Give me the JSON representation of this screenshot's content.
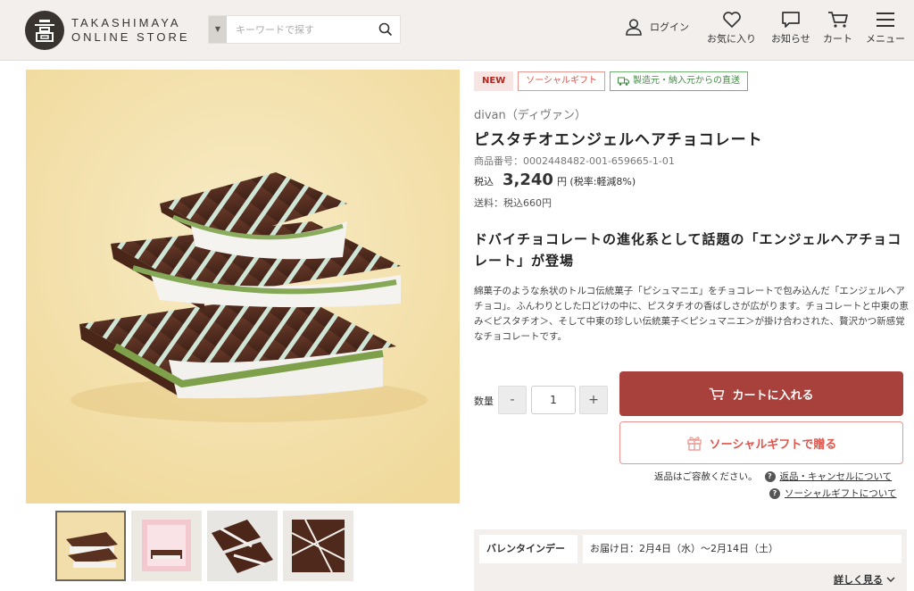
{
  "header": {
    "logo_line1": "TAKASHIMAYA",
    "logo_line2": "ONLINE STORE",
    "search_placeholder": "キーワードで探す",
    "login": "ログイン",
    "favorites": "お気に入り",
    "notices": "お知らせ",
    "cart": "カート",
    "menu": "メニュー"
  },
  "tags": {
    "new": "NEW",
    "social_gift": "ソーシャルギフト",
    "direct": "製造元・納入元からの直送"
  },
  "product": {
    "brand": "divan（ディヴァン）",
    "title": "ピスタチオエンジェルヘアチョコレート",
    "number": "商品番号：0002448482-001-659665-1-01",
    "price_prefix": "税込",
    "price": "3,240",
    "price_unit": "円 (税率:軽減8%)",
    "shipping": "送料：税込660円",
    "headline": "ドバイチョコレートの進化系として話題の「エンジェルヘアチョコレート」が登場",
    "description": "綿菓子のような糸状のトルコ伝統菓子「ピシュマニエ」をチョコレートで包み込んだ「エンジェルヘアチョコ」。ふんわりとした口どけの中に、ピスタチオの香ばしさが広がります。チョコレートと中東の恵み＜ピスタチオ＞、そして中東の珍しい伝統菓子＜ピシュマニエ＞が掛け合わされた、贅沢かつ新感覚なチョコレートです。"
  },
  "purchase": {
    "qty_label": "数量",
    "qty_minus": "-",
    "qty_value": "1",
    "qty_plus": "+",
    "cart_button": "カートに入れる",
    "gift_button": "ソーシャルギフトで贈る",
    "return_note": "返品はご容赦ください。",
    "return_link": "返品・キャンセルについて",
    "social_link": "ソーシャルギフトについて"
  },
  "event": {
    "label": "バレンタインデー",
    "value": "お届け日：2月4日（水）～2月14日（土）",
    "more": "詳しく見る"
  },
  "thumbnails": [
    {
      "name": "chocolate-pieces"
    },
    {
      "name": "package-box"
    },
    {
      "name": "chocolate-bars"
    },
    {
      "name": "chocolate-tablet"
    }
  ],
  "colors": {
    "header_bg": "#f2efed",
    "accent": "#a8413b",
    "social": "#e0554c",
    "direct": "#418c44"
  }
}
